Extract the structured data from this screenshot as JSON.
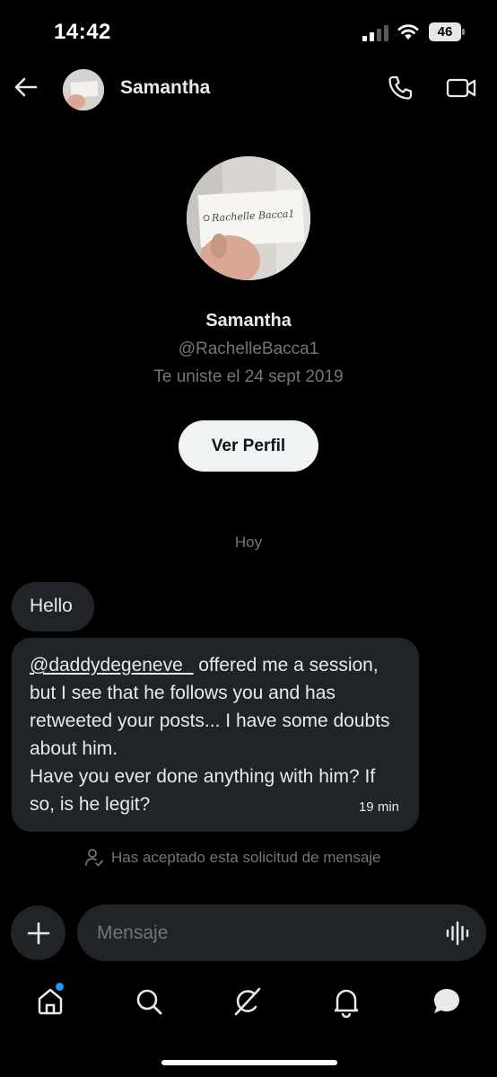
{
  "status_bar": {
    "time": "14:42",
    "battery": "46"
  },
  "header": {
    "name": "Samantha"
  },
  "profile": {
    "name": "Samantha",
    "handle": "@RachelleBacca1",
    "joined": "Te uniste el 24 sept 2019",
    "view_profile_label": "Ver Perfil",
    "avatar_sign_text": "Rachelle Bacca1"
  },
  "conversation": {
    "date_label": "Hoy",
    "messages": [
      {
        "text": "Hello"
      },
      {
        "mention": "@daddydegeneve_",
        "text": " offered me a session, but I see that he follows you and has retweeted your posts... I have some doubts about him.",
        "text2": "Have you ever done anything with him? If so, is he legit?",
        "time": "19 min"
      }
    ],
    "accepted_note": "Has aceptado esta solicitud de mensaje"
  },
  "compose": {
    "placeholder": "Mensaje"
  },
  "icons": {
    "back": "arrow-left-icon",
    "call": "phone-icon",
    "video": "video-camera-icon",
    "add": "plus-icon",
    "voice": "voice-waveform-icon",
    "nav": [
      "home-icon",
      "search-icon",
      "grok-icon",
      "bell-icon",
      "messages-icon"
    ]
  },
  "colors": {
    "background": "#000000",
    "bubble": "#202327",
    "muted": "#71767b",
    "accent": "#1d9bf0",
    "button": "#eff3f4"
  }
}
